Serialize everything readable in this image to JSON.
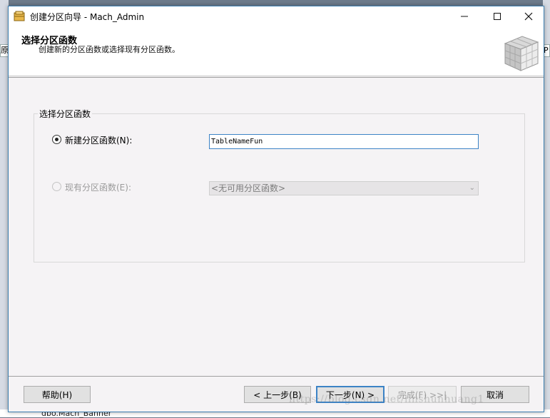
{
  "window": {
    "title": "创建分区向导 - Mach_Admin",
    "icon": "database-icon"
  },
  "header": {
    "title": "选择分区函数",
    "subtitle": "创建新的分区函数或选择现有分区函数。"
  },
  "group": {
    "label": "选择分区函数",
    "new_function": {
      "label": "新建分区函数(N):",
      "selected": true,
      "value": "TableNameFun"
    },
    "existing_function": {
      "label": "现有分区函数(E):",
      "selected": false,
      "enabled": false,
      "selected_value": "<无可用分区函数>"
    }
  },
  "buttons": {
    "help": "帮助(H)",
    "prev": "< 上一步(B)",
    "next": "下一步(N) >",
    "finish": "完成(F) >>|",
    "cancel": "取消"
  },
  "background": {
    "left_text": "原",
    "right_text": "P",
    "tree_item": "dbo.Mach_Banner"
  },
  "watermark": "https://blog.csdn.net/linshunhuang1",
  "colors": {
    "accent": "#3c83c6",
    "dialog_bg": "#f5f3f5"
  }
}
